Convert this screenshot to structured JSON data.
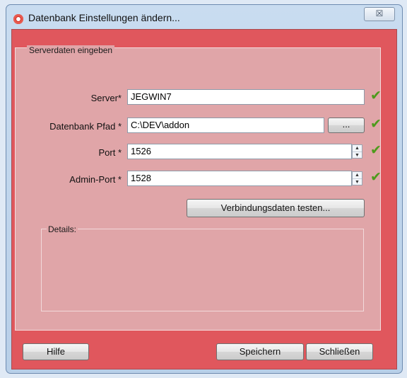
{
  "window": {
    "title": "Datenbank Einstellungen ändern...",
    "close_label": "☒"
  },
  "group": {
    "title": "Serverdaten eingeben"
  },
  "fields": {
    "server": {
      "label": "Server*",
      "value": "JEGWIN7"
    },
    "pfad": {
      "label": "Datenbank Pfad *",
      "value": "C:\\DEV\\addon",
      "browse_label": "..."
    },
    "port": {
      "label": "Port *",
      "value": "1526"
    },
    "admin_port": {
      "label": "Admin-Port *",
      "value": "1528"
    }
  },
  "test_button": "Verbindungsdaten testen...",
  "details": {
    "title": "Details:"
  },
  "footer": {
    "help": "Hilfe",
    "save": "Speichern",
    "close": "Schließen"
  },
  "icons": {
    "check": "check-icon",
    "app": "app-icon"
  },
  "colors": {
    "accent": "#e0575d",
    "panel": "#e0a5a8",
    "check": "#4e9a1c"
  }
}
